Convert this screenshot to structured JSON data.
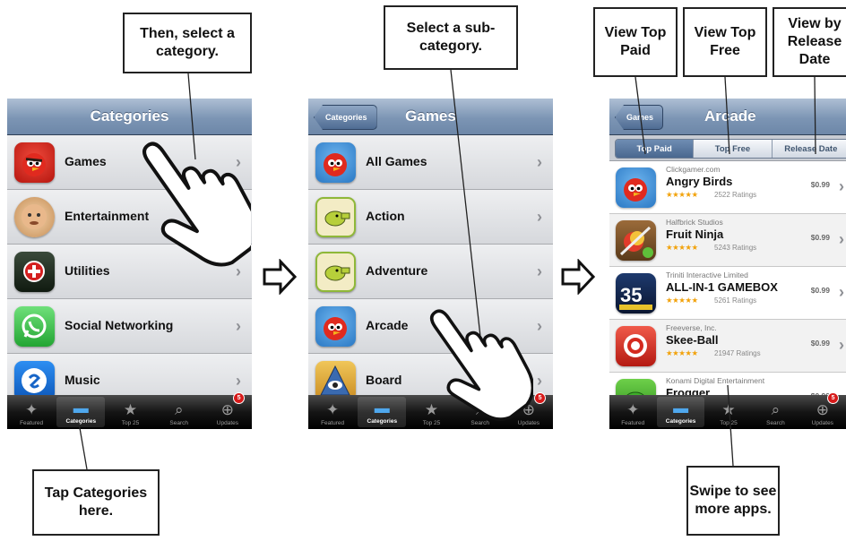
{
  "callouts": {
    "select_category": "Then, select a category.",
    "select_subcategory": "Select a sub-category.",
    "view_top_paid": "View Top Paid",
    "view_top_free": "View Top Free",
    "view_release": "View by Release Date",
    "tap_categories": "Tap Categories here.",
    "swipe": "Swipe to see more apps."
  },
  "screen1": {
    "title": "Categories",
    "rows": [
      "Games",
      "Entertainment",
      "Utilities",
      "Social Networking",
      "Music"
    ]
  },
  "screen2": {
    "back": "Categories",
    "title": "Games",
    "rows": [
      "All Games",
      "Action",
      "Adventure",
      "Arcade",
      "Board"
    ]
  },
  "screen3": {
    "back": "Games",
    "title": "Arcade",
    "segments": [
      "Top Paid",
      "Top Free",
      "Release Date"
    ],
    "apps": [
      {
        "dev": "Clickgamer.com",
        "name": "Angry Birds",
        "ratings": "2522 Ratings",
        "price": "$0.99"
      },
      {
        "dev": "Halfbrick Studios",
        "name": "Fruit Ninja",
        "ratings": "5243 Ratings",
        "price": "$0.99"
      },
      {
        "dev": "Triniti Interactive Limited",
        "name": "ALL-IN-1 GAMEBOX",
        "ratings": "5261 Ratings",
        "price": "$0.99"
      },
      {
        "dev": "Freeverse, Inc.",
        "name": "Skee-Ball",
        "ratings": "21947 Ratings",
        "price": "$0.99"
      },
      {
        "dev": "Konami Digital Entertainment",
        "name": "Frogger",
        "ratings": "",
        "price": "$0.99"
      }
    ]
  },
  "tabbar": {
    "tabs": [
      "Featured",
      "Categories",
      "Top 25",
      "Search",
      "Updates"
    ],
    "badge": "5"
  },
  "icons": {
    "star": "★★★★★",
    "chevron": "›"
  }
}
